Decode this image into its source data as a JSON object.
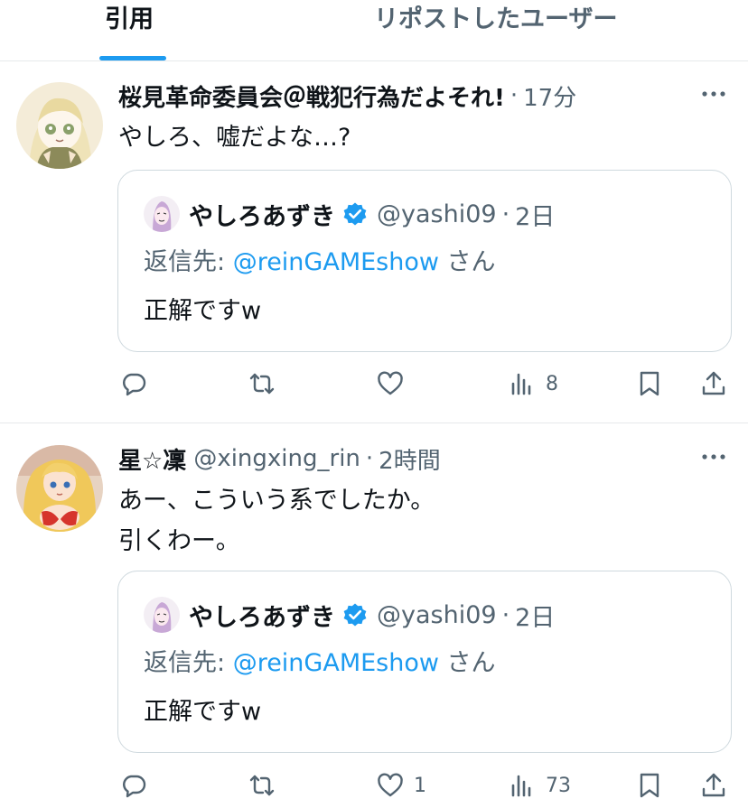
{
  "tabs": {
    "quotes_label": "引用",
    "reposts_label": "リポストしたユーザー"
  },
  "quoted": {
    "name": "やしろあずき",
    "handle": "@yashi09",
    "time": "2日",
    "reply_prefix": "返信先: ",
    "reply_mention": "@reinGAMEshow",
    "reply_suffix": " さん",
    "text": "正解ですw"
  },
  "posts": [
    {
      "name": "桜見革命委員会＠戦犯行為だよそれ!",
      "handle": "",
      "time": "17分",
      "text": [
        "やしろ、嘘だよな…?"
      ],
      "like_count": "",
      "view_count": "8"
    },
    {
      "name": "星☆凜",
      "handle": "@xingxing_rin",
      "time": "2時間",
      "text": [
        "あー、こういう系でしたか。",
        "引くわー。"
      ],
      "like_count": "1",
      "view_count": "73"
    }
  ],
  "colors": {
    "accent": "#1d9bf0",
    "secondary_text": "#536471",
    "border": "#cfd9de"
  }
}
